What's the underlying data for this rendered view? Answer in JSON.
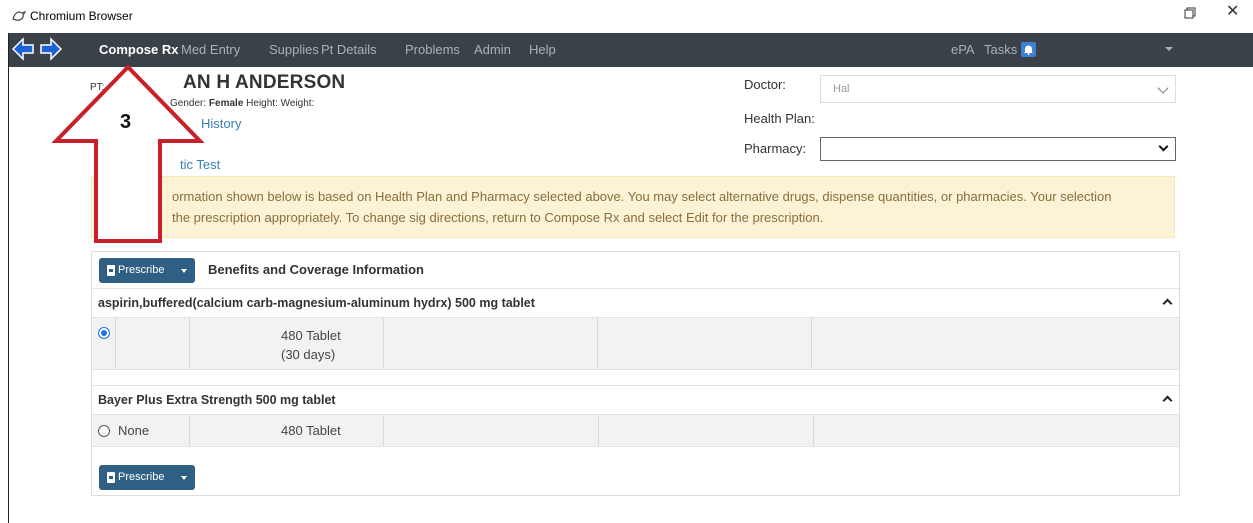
{
  "window": {
    "title": "Chromium Browser"
  },
  "nav": {
    "items": [
      "Compose Rx",
      "Med Entry",
      "Supplies",
      "Pt Details",
      "Problems",
      "Admin",
      "Help"
    ],
    "epa": "ePA",
    "tasks": "Tasks",
    "tasks_badge": "🔔"
  },
  "patient": {
    "pt_label": "PT:",
    "name": "AN H ANDERSON",
    "gender_label": "Gender:",
    "gender_value": "Female",
    "height_label": "Height:",
    "weight_label": "Weight:",
    "history_link": "History",
    "test_link": "tic Test"
  },
  "form": {
    "doctor_label": "Doctor:",
    "doctor_value": "Hal",
    "health_plan_label": "Health Plan:",
    "pharmacy_label": "Pharmacy:",
    "pharmacy_value": ""
  },
  "alert": {
    "line1": "ormation shown below is based on Health Plan and Pharmacy selected above. You may select alternative drugs, dispense quantities, or pharmacies. Your selection",
    "line2": "the prescription appropriately. To change sig directions, return to Compose Rx and select Edit for the prescription."
  },
  "annotation": {
    "number": "3"
  },
  "panel": {
    "prescribe_label": "Prescribe",
    "title": "Benefits and Coverage Information",
    "drugs": [
      {
        "name": "aspirin,buffered(calcium carb-magnesium-aluminum hydrx) 500 mg tablet",
        "option_label": "",
        "quantity": "480 Tablet",
        "days": "(30 days)",
        "selected": true
      },
      {
        "name": "Bayer Plus Extra Strength 500 mg tablet",
        "option_label": "None",
        "quantity": "480 Tablet",
        "days": "",
        "selected": false
      }
    ]
  },
  "colors": {
    "navbar": "#3a4148",
    "button": "#2f5f83",
    "alert_bg": "#fcf3d6",
    "alert_text": "#8a6d3b",
    "annotation_arrow": "#c8202a"
  }
}
